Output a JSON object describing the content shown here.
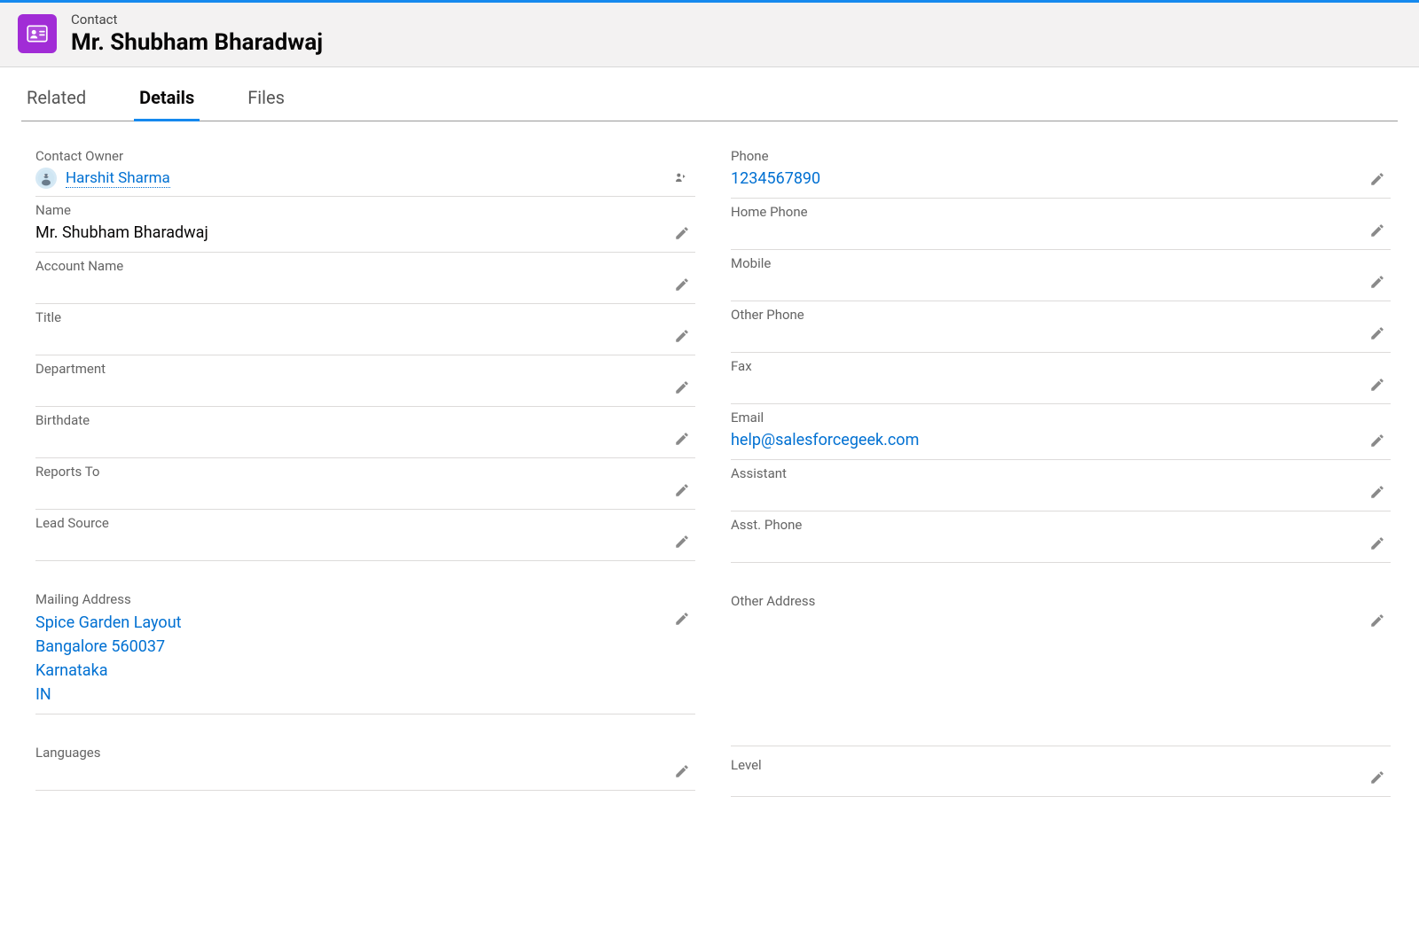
{
  "header": {
    "object_label": "Contact",
    "record_name": "Mr. Shubham Bharadwaj"
  },
  "tabs": {
    "related": "Related",
    "details": "Details",
    "files": "Files"
  },
  "left": {
    "contact_owner_label": "Contact Owner",
    "contact_owner_value": "Harshit Sharma",
    "name_label": "Name",
    "name_value": "Mr. Shubham Bharadwaj",
    "account_name_label": "Account Name",
    "account_name_value": "",
    "title_label": "Title",
    "title_value": "",
    "department_label": "Department",
    "department_value": "",
    "birthdate_label": "Birthdate",
    "birthdate_value": "",
    "reports_to_label": "Reports To",
    "reports_to_value": "",
    "lead_source_label": "Lead Source",
    "lead_source_value": "",
    "mailing_address_label": "Mailing Address",
    "mailing_address": {
      "line1": "Spice Garden Layout",
      "line2": "Bangalore 560037",
      "line3": "Karnataka",
      "line4": "IN"
    },
    "languages_label": "Languages",
    "languages_value": ""
  },
  "right": {
    "phone_label": "Phone",
    "phone_value": "1234567890",
    "home_phone_label": "Home Phone",
    "home_phone_value": "",
    "mobile_label": "Mobile",
    "mobile_value": "",
    "other_phone_label": "Other Phone",
    "other_phone_value": "",
    "fax_label": "Fax",
    "fax_value": "",
    "email_label": "Email",
    "email_value": "help@salesforcegeek.com",
    "assistant_label": "Assistant",
    "assistant_value": "",
    "asst_phone_label": "Asst. Phone",
    "asst_phone_value": "",
    "other_address_label": "Other Address",
    "other_address_value": "",
    "level_label": "Level",
    "level_value": ""
  }
}
